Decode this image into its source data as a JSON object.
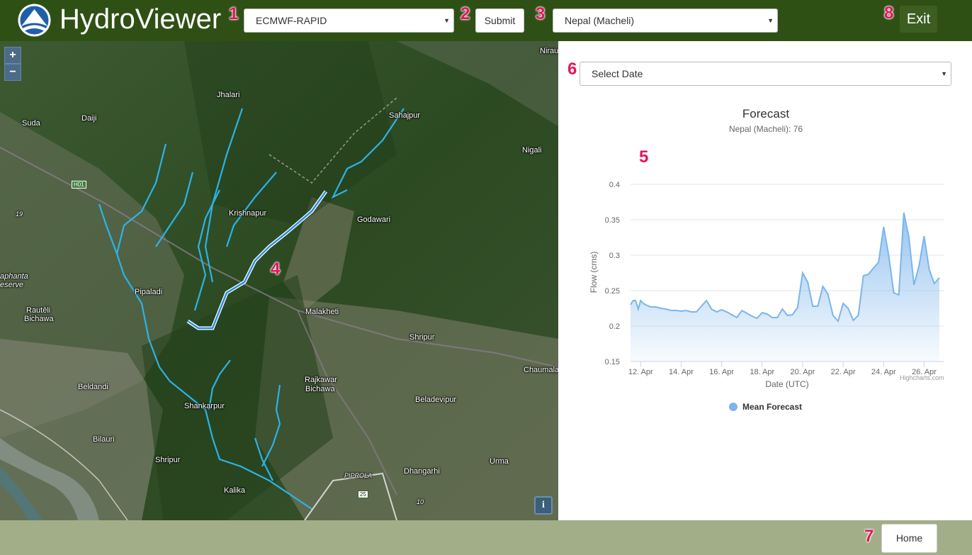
{
  "header": {
    "app_title": "HydroViewer",
    "model_select": "ECMWF-RAPID",
    "submit_label": "Submit",
    "region_select": "Nepal (Macheli)",
    "exit_label": "Exit"
  },
  "markers": [
    "1",
    "2",
    "3",
    "4",
    "5",
    "6",
    "7",
    "8"
  ],
  "map": {
    "zoom_in": "+",
    "zoom_out": "−",
    "info": "i",
    "labels": [
      "Nirau",
      "Jhalari",
      "Sahajpur",
      "Suda",
      "Daiji",
      "Nigali",
      "Krishnapur",
      "Godawari",
      "Pipaladi",
      "Rautêli",
      "Bichawa",
      "Malakheti",
      "Shripur",
      "Chaumala",
      "Rajkawar",
      "Bichawa",
      "Beladevipur",
      "Beldandi",
      "Shankarpur",
      "Bilauri",
      "Shripur",
      "Dhangarhi",
      "Urma",
      "Kalika",
      "PIPROLA",
      "25",
      "H01",
      "aphanta",
      "eserve",
      "19",
      "10"
    ]
  },
  "panel": {
    "date_select": "Select Date"
  },
  "chart_data": {
    "type": "area",
    "title": "Forecast",
    "subtitle": "Nepal (Macheli): 76",
    "xlabel": "Date (UTC)",
    "ylabel": "Flow (cms)",
    "ylim": [
      0.15,
      0.4
    ],
    "yticks": [
      "0.4",
      "0.35",
      "0.3",
      "0.25",
      "0.2",
      "0.15"
    ],
    "xticks": [
      "12. Apr",
      "14. Apr",
      "16. Apr",
      "18. Apr",
      "20. Apr",
      "22. Apr",
      "24. Apr",
      "26. Apr"
    ],
    "xrange": [
      "11.5 Apr",
      "27.0 Apr"
    ],
    "legend": "Mean Forecast",
    "credits": "Highcharts.com",
    "series": [
      {
        "name": "Mean Forecast",
        "color": "#7cb5ec",
        "x_days": [
          11.5,
          11.63,
          11.75,
          11.88,
          12.0,
          12.13,
          12.25,
          12.5,
          12.75,
          13.0,
          13.25,
          13.5,
          13.75,
          14.0,
          14.25,
          14.5,
          14.75,
          15.0,
          15.25,
          15.5,
          15.75,
          16.0,
          16.25,
          16.5,
          16.75,
          17.0,
          17.25,
          17.5,
          17.75,
          18.0,
          18.25,
          18.5,
          18.75,
          19.0,
          19.25,
          19.5,
          19.75,
          20.0,
          20.25,
          20.5,
          20.75,
          21.0,
          21.25,
          21.5,
          21.75,
          22.0,
          22.25,
          22.5,
          22.75,
          23.0,
          23.25,
          23.5,
          23.75,
          24.0,
          24.25,
          24.5,
          24.75,
          25.0,
          25.25,
          25.5,
          25.75,
          26.0,
          26.25,
          26.5,
          26.75
        ],
        "values": [
          0.23,
          0.236,
          0.236,
          0.224,
          0.236,
          0.232,
          0.23,
          0.227,
          0.227,
          0.225,
          0.224,
          0.222,
          0.222,
          0.221,
          0.222,
          0.22,
          0.22,
          0.228,
          0.236,
          0.224,
          0.22,
          0.223,
          0.22,
          0.216,
          0.212,
          0.222,
          0.218,
          0.214,
          0.211,
          0.219,
          0.217,
          0.212,
          0.212,
          0.224,
          0.215,
          0.216,
          0.226,
          0.275,
          0.262,
          0.228,
          0.228,
          0.256,
          0.245,
          0.215,
          0.207,
          0.232,
          0.225,
          0.208,
          0.215,
          0.271,
          0.273,
          0.282,
          0.29,
          0.34,
          0.3,
          0.247,
          0.244,
          0.36,
          0.325,
          0.258,
          0.285,
          0.327,
          0.28,
          0.26,
          0.268
        ]
      }
    ]
  },
  "footer": {
    "home_label": "Home"
  }
}
